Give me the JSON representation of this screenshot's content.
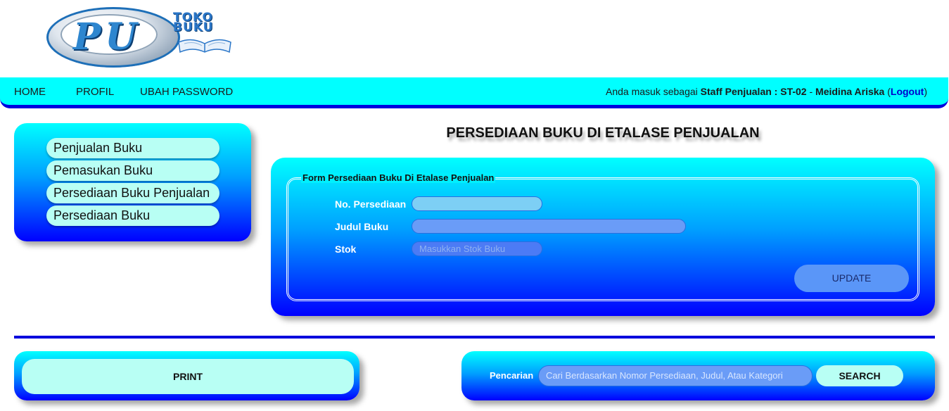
{
  "logo": {
    "monogram": "PU",
    "line1": "TOKO",
    "line2": "BUKU"
  },
  "nav": {
    "home": "HOME",
    "profil": "PROFIL",
    "ubah_password": "UBAH PASSWORD",
    "user_prefix": "Anda masuk sebagai",
    "user_role": "Staff Penjualan : ST-02",
    "user_sep": "-",
    "user_name": "Meidina Ariska",
    "open_paren": "(",
    "logout": "Logout",
    "close_paren": ")"
  },
  "sidebar": {
    "items": [
      {
        "label": "Penjualan Buku"
      },
      {
        "label": "Pemasukan Buku"
      },
      {
        "label": "Persediaan Buku Penjualan"
      },
      {
        "label": "Persediaan Buku"
      }
    ]
  },
  "page": {
    "title": "PERSEDIAAN BUKU DI ETALASE PENJUALAN"
  },
  "form": {
    "legend": "Form Persediaan Buku Di Etalase Penjualan",
    "no_persediaan_label": "No. Persediaan",
    "no_persediaan_value": "",
    "judul_label": "Judul Buku",
    "judul_value": "",
    "stok_label": "Stok",
    "stok_placeholder": "Masukkan Stok Buku",
    "update_label": "UPDATE"
  },
  "print": {
    "label": "PRINT"
  },
  "search": {
    "label": "Pencarian",
    "placeholder": "Cari Berdasarkan Nomor Persediaan, Judul, Atau Kategori",
    "button": "SEARCH"
  },
  "colors": {
    "panel_top": "#00ffff",
    "panel_bottom": "#0000ff",
    "pill": "#b8fff4",
    "nav_bg": "#00ffff",
    "accent": "#0000dd"
  }
}
